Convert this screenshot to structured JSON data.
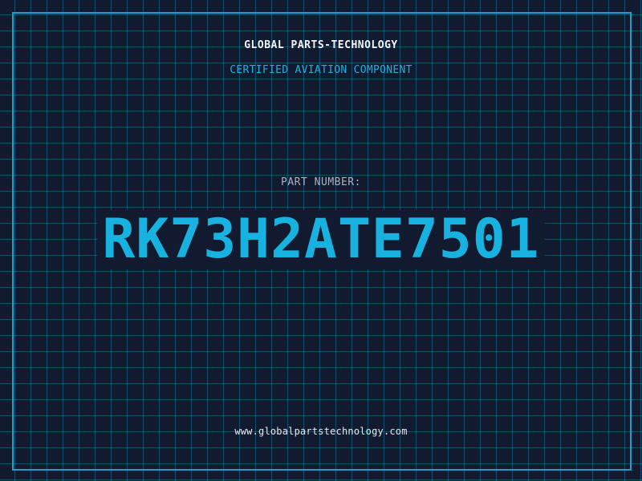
{
  "header": {
    "company": "GLOBAL PARTS-TECHNOLOGY",
    "subtitle": "CERTIFIED AVIATION COMPONENT"
  },
  "part": {
    "label": "PART NUMBER:",
    "number": "RK73H2ATE7501"
  },
  "footer": {
    "website": "www.globalpartstechnology.com"
  },
  "colors": {
    "background": "#111a2e",
    "grid": "#1e8cb4",
    "accent": "#17b2e0",
    "text_primary": "#f2f4f8",
    "text_muted": "#a9b3c4"
  }
}
